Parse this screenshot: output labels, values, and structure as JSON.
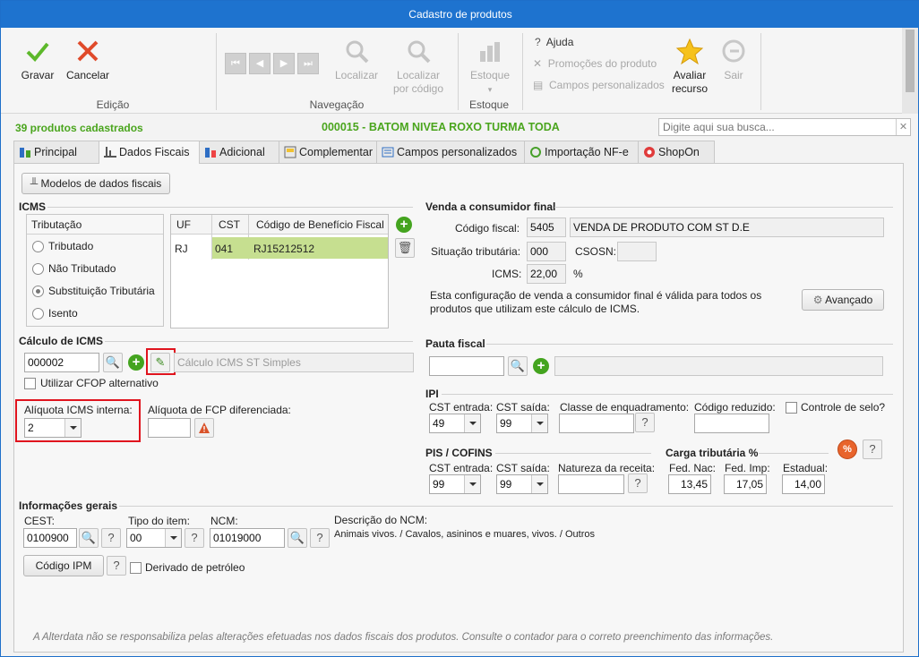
{
  "window": {
    "title": "Cadastro de produtos"
  },
  "ribbon": {
    "groups": {
      "edicao": "Edição",
      "navegacao": "Navegação",
      "estoque": "Estoque"
    },
    "buttons": {
      "gravar": "Gravar",
      "cancelar": "Cancelar",
      "localizar": "Localizar",
      "localizar_codigo_1": "Localizar",
      "localizar_codigo_2": "por código",
      "estoque": "Estoque",
      "ajuda": "Ajuda",
      "promocoes": "Promoções do produto",
      "campos": "Campos personalizados",
      "avaliar_1": "Avaliar",
      "avaliar_2": "recurso",
      "sair": "Sair"
    }
  },
  "header": {
    "product_count": "39 produtos cadastrados",
    "product_name": "000015 - BATOM NIVEA ROXO TURMA TODA",
    "search_placeholder": "Digite aqui sua busca..."
  },
  "tabs": [
    "Principal",
    "Dados Fiscais",
    "Adicional",
    "Complementar",
    "Campos personalizados",
    "Importação NF-e",
    "ShopOn"
  ],
  "fiscal": {
    "modelos_button": "Modelos de dados fiscais",
    "icms": {
      "title": "ICMS",
      "tributacao_label": "Tributação",
      "options": [
        "Tributado",
        "Não Tributado",
        "Substituição Tributária",
        "Isento"
      ],
      "selected_option": "Substituição Tributária",
      "table": {
        "headers": [
          "UF",
          "CST",
          "Código de Benefício Fiscal"
        ],
        "rows": [
          [
            "RJ",
            "041",
            "RJ15212512"
          ]
        ]
      }
    },
    "calculo": {
      "title": "Cálculo de ICMS",
      "code": "000002",
      "description": "Cálculo ICMS ST Simples",
      "cfop_label": "Utilizar CFOP alternativo",
      "aliquota_label": "Alíquota ICMS interna:",
      "aliquota_value": "2",
      "fcp_label": "Alíquota de FCP diferenciada:"
    },
    "venda": {
      "title": "Venda a consumidor final",
      "codigo_label": "Código fiscal:",
      "codigo_value": "5405",
      "codigo_desc": "VENDA DE PRODUTO COM ST D.E",
      "situacao_label": "Situação tributária:",
      "situacao_value": "000",
      "csosn_label": "CSOSN:",
      "icms_label": "ICMS:",
      "icms_value": "22,00",
      "icms_unit": "%",
      "note_1": "Esta configuração de venda a consumidor final é válida para todos os",
      "note_2": "produtos que utilizam este cálculo de ICMS.",
      "avancado_button": "Avançado"
    },
    "pauta": {
      "title": "Pauta fiscal"
    },
    "ipi": {
      "title": "IPI",
      "cst_entrada_label": "CST entrada:",
      "cst_entrada_value": "49",
      "cst_saida_label": "CST saída:",
      "cst_saida_value": "99",
      "classe_label": "Classe de enquadramento:",
      "codigo_reduzido_label": "Código reduzido:",
      "controle_selo_label": "Controle de selo?"
    },
    "pis": {
      "title": "PIS / COFINS",
      "cst_entrada_label": "CST entrada:",
      "cst_entrada_value": "99",
      "cst_saida_label": "CST saída:",
      "cst_saida_value": "99",
      "natureza_label": "Natureza da receita:"
    },
    "carga": {
      "title": "Carga tributária %",
      "fed_nac_label": "Fed. Nac:",
      "fed_nac_value": "13,45",
      "fed_imp_label": "Fed. Imp:",
      "fed_imp_value": "17,05",
      "estadual_label": "Estadual:",
      "estadual_value": "14,00"
    },
    "gerais": {
      "title": "Informações gerais",
      "cest_label": "CEST:",
      "cest_value": "0100900",
      "tipo_label": "Tipo do item:",
      "tipo_value": "00",
      "ncm_label": "NCM:",
      "ncm_value": "01019000",
      "desc_ncm_label": "Descrição do NCM:",
      "desc_ncm_value": "Animais vivos. / Cavalos, asininos e muares, vivos. / Outros",
      "ipm_button": "Código IPM",
      "petroleo_label": "Derivado de petróleo"
    },
    "footer_note": "A Alterdata não se responsabiliza pelas alterações efetuadas nos dados fiscais dos produtos. Consulte o contador para o correto preenchimento das informações."
  },
  "colors": {
    "accent_green": "#4aa51d",
    "title_blue": "#1e73cf",
    "highlight_red": "#e0141e"
  }
}
